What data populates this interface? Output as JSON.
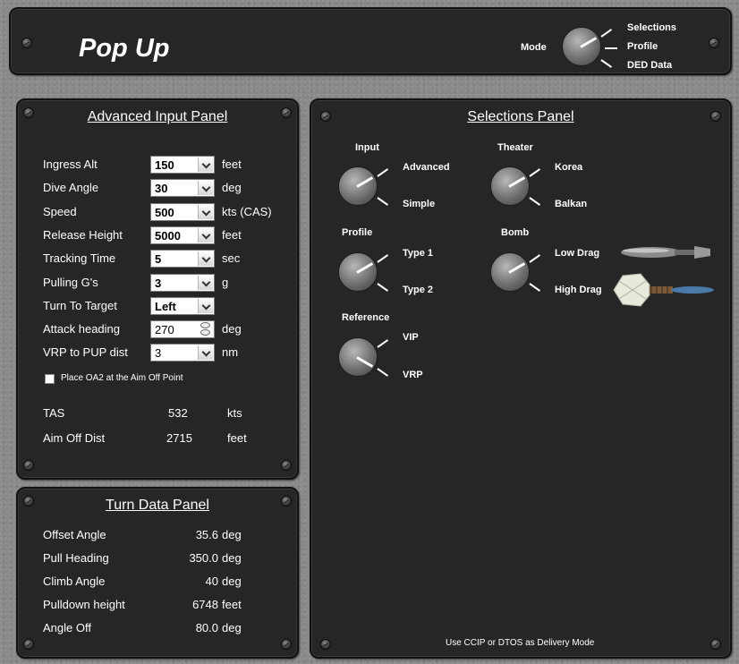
{
  "header": {
    "title": "Pop Up",
    "mode_label": "Mode",
    "mode_options": [
      "Selections",
      "Profile",
      "DED Data"
    ]
  },
  "advanced": {
    "title": "Advanced Input Panel",
    "rows": [
      {
        "label": "Ingress Alt",
        "value": "150",
        "unit": "feet"
      },
      {
        "label": "Dive Angle",
        "value": "30",
        "unit": "deg"
      },
      {
        "label": "Speed",
        "value": "500",
        "unit": "kts (CAS)"
      },
      {
        "label": "Release Height",
        "value": "5000",
        "unit": "feet"
      },
      {
        "label": "Tracking Time",
        "value": "5",
        "unit": "sec"
      },
      {
        "label": "Pulling G's",
        "value": "3",
        "unit": "g"
      },
      {
        "label": "Turn To Target",
        "value": "Left",
        "unit": ""
      },
      {
        "label": "Attack heading",
        "value": "270",
        "unit": "deg"
      },
      {
        "label": "VRP to PUP dist",
        "value": "3",
        "unit": "nm"
      }
    ],
    "checkbox_label": "Place OA2 at the Aim Off Point",
    "tas_label": "TAS",
    "tas_value": "532",
    "tas_unit": "kts",
    "aim_label": "Aim Off Dist",
    "aim_value": "2715",
    "aim_unit": "feet"
  },
  "turn": {
    "title": "Turn Data Panel",
    "rows": [
      {
        "label": "Offset Angle",
        "value": "35.6",
        "unit": "deg"
      },
      {
        "label": "Pull Heading",
        "value": "350.0",
        "unit": "deg"
      },
      {
        "label": "Climb Angle",
        "value": "40",
        "unit": "deg"
      },
      {
        "label": "Pulldown height",
        "value": "6748",
        "unit": "feet"
      },
      {
        "label": "Angle Off",
        "value": "80.0",
        "unit": "deg"
      }
    ]
  },
  "selections": {
    "title": "Selections Panel",
    "input": {
      "title": "Input",
      "opt1": "Advanced",
      "opt2": "Simple"
    },
    "theater": {
      "title": "Theater",
      "opt1": "Korea",
      "opt2": "Balkan"
    },
    "profile": {
      "title": "Profile",
      "opt1": "Type 1",
      "opt2": "Type 2"
    },
    "bomb": {
      "title": "Bomb",
      "opt1": "Low Drag",
      "opt2": "High Drag"
    },
    "reference": {
      "title": "Reference",
      "opt1": "VIP",
      "opt2": "VRP"
    },
    "footer": "Use CCIP or DTOS as Delivery Mode"
  },
  "colors": {
    "panel": "#262626",
    "background": "#8a8a8a",
    "text": "#ffffff"
  }
}
